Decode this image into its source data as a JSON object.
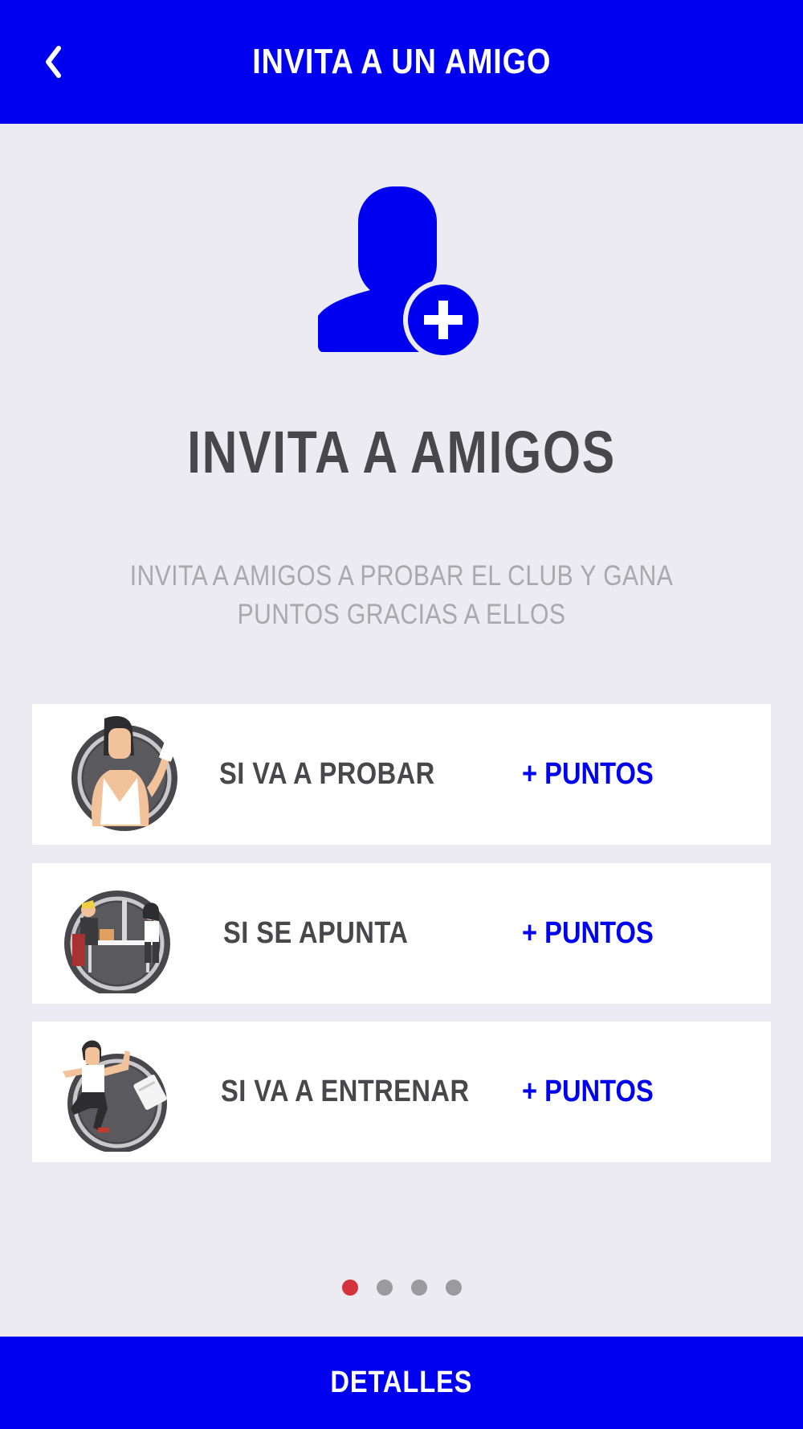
{
  "header": {
    "title": "INVITA A UN AMIGO",
    "back_icon": "chevron-left-icon"
  },
  "hero": {
    "icon": "add-user-icon",
    "title": "INVITA A AMIGOS",
    "subtitle": "INVITA A AMIGOS A PROBAR EL CLUB Y GANA PUNTOS GRACIAS A ELLOS"
  },
  "rewards": [
    {
      "label": "SI VA A PROBAR",
      "points": "+ PUNTOS",
      "illustration": "woman-card-illustration"
    },
    {
      "label": "SI SE APUNTA",
      "points": "+ PUNTOS",
      "illustration": "office-desk-illustration"
    },
    {
      "label": "SI VA A ENTRENAR",
      "points": "+ PUNTOS",
      "illustration": "woman-running-illustration"
    }
  ],
  "pagination": {
    "total": 4,
    "active": 1
  },
  "footer": {
    "button_label": "DETALLES"
  },
  "colors": {
    "accent": "#0000f0",
    "background": "#ecebf1",
    "title_text": "#48484c",
    "subtitle_text": "#a8a8ad",
    "active_dot": "#d3343b",
    "inactive_dot": "#9b9b9f"
  }
}
